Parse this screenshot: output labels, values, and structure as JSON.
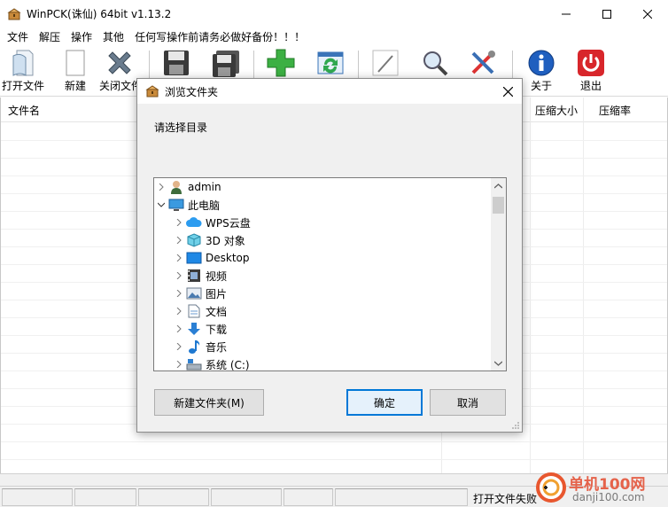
{
  "window": {
    "title": "WinPCK(诛仙) 64bit v1.13.2"
  },
  "menu": [
    "文件",
    "解压",
    "操作",
    "其他",
    "任何写操作前请务必做好备份！！！"
  ],
  "toolbar": {
    "open": "打开文件",
    "new": "新建",
    "close": "关闭文件",
    "about": "关于",
    "exit": "退出"
  },
  "list": {
    "col_filename": "文件名",
    "col_compressed": "压缩大小",
    "col_ratio": "压缩率"
  },
  "status": {
    "message": "打开文件失败"
  },
  "watermark": {
    "brand": "单机100网",
    "domain": "danji100.com"
  },
  "dialog": {
    "title": "浏览文件夹",
    "prompt": "请选择目录",
    "tree": [
      {
        "label": "admin",
        "icon": "user-icon",
        "level": 0,
        "expanded": false
      },
      {
        "label": "此电脑",
        "icon": "computer-icon",
        "level": 0,
        "expanded": true
      },
      {
        "label": "WPS云盘",
        "icon": "cloud-icon",
        "level": 1,
        "expanded": false
      },
      {
        "label": "3D 对象",
        "icon": "cube-icon",
        "level": 1,
        "expanded": false
      },
      {
        "label": "Desktop",
        "icon": "desktop-icon",
        "level": 1,
        "expanded": false
      },
      {
        "label": "视频",
        "icon": "video-icon",
        "level": 1,
        "expanded": false
      },
      {
        "label": "图片",
        "icon": "picture-icon",
        "level": 1,
        "expanded": false
      },
      {
        "label": "文档",
        "icon": "document-icon",
        "level": 1,
        "expanded": false
      },
      {
        "label": "下载",
        "icon": "download-icon",
        "level": 1,
        "expanded": false
      },
      {
        "label": "音乐",
        "icon": "music-icon",
        "level": 1,
        "expanded": false
      },
      {
        "label": "系统 (C:)",
        "icon": "drive-icon",
        "level": 1,
        "expanded": false
      }
    ],
    "btn_new_folder": "新建文件夹(M)",
    "btn_ok": "确定",
    "btn_cancel": "取消"
  }
}
